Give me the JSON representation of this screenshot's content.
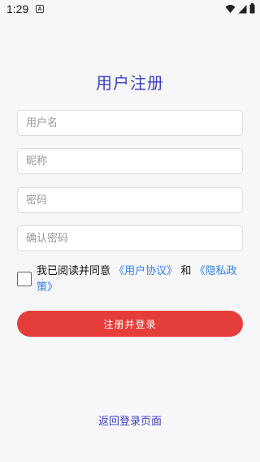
{
  "status_bar": {
    "time": "1:29",
    "notification_icon": "A",
    "icons": [
      "wifi-icon",
      "signal-icon",
      "battery-icon"
    ]
  },
  "title": "用户注册",
  "form": {
    "username_placeholder": "用户名",
    "nickname_placeholder": "昵称",
    "password_placeholder": "密码",
    "confirm_password_placeholder": "确认密码"
  },
  "agreement": {
    "prefix": "我已阅读并同意",
    "user_agreement": "《用户协议》",
    "and": "和",
    "privacy_policy": "《隐私政策》",
    "checked": false
  },
  "submit_label": "注册并登录",
  "back_link": "返回登录页面",
  "colors": {
    "title": "#3b3fbf",
    "link": "#2f7ef0",
    "submit_bg": "#e53e3a"
  }
}
